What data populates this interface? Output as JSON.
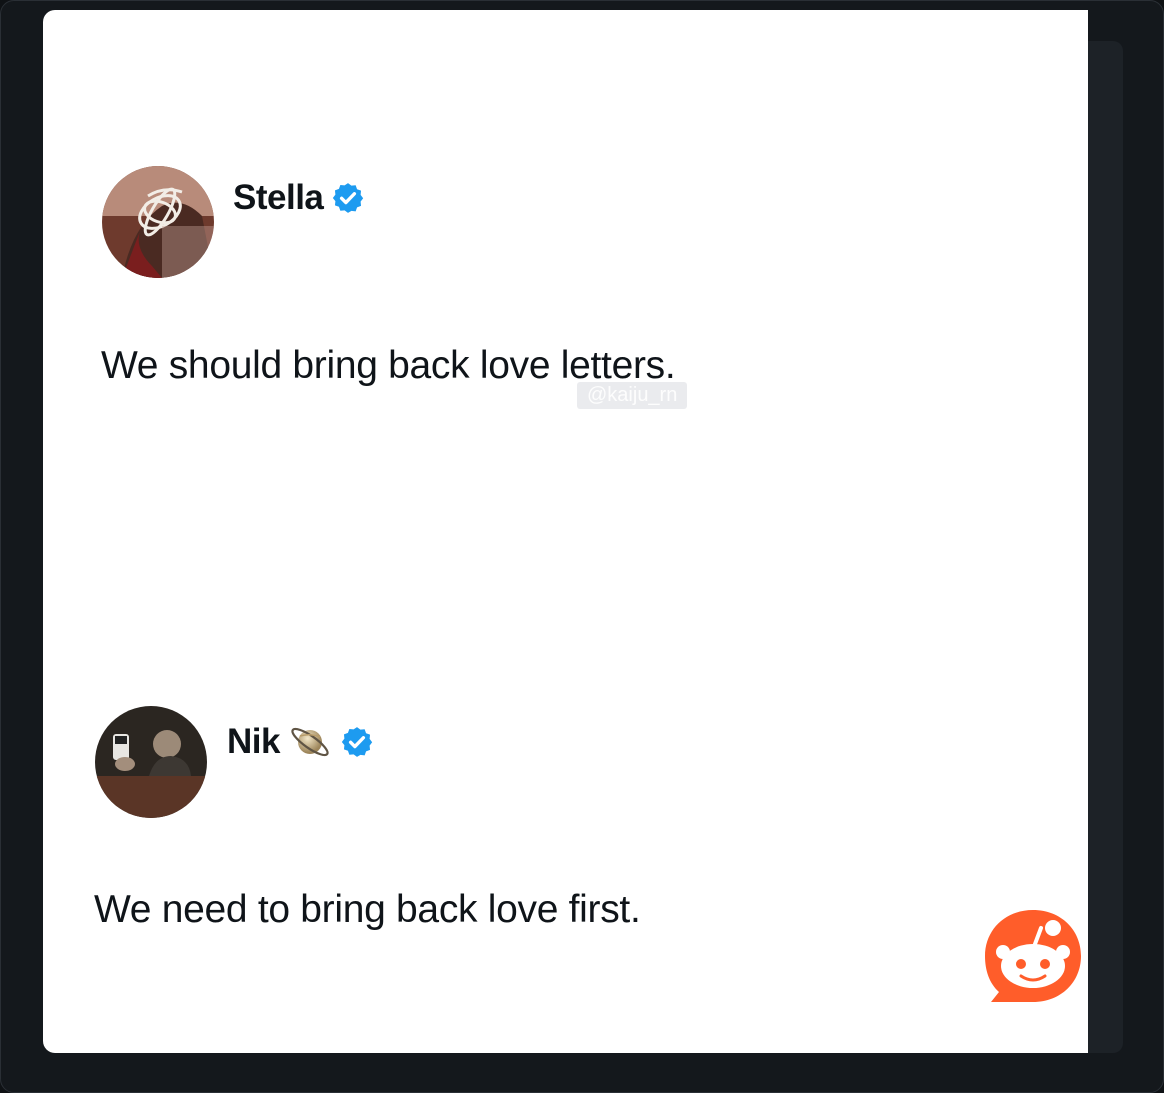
{
  "tweets": [
    {
      "author": "Stella",
      "verified": true,
      "text": "We should bring back love letters."
    },
    {
      "author": "Nik",
      "verified": true,
      "emoji": "planet-emoji",
      "text": "We need to bring back love first."
    }
  ],
  "watermark": "@kaiju_rn",
  "colors": {
    "verified": "#1d9bf0",
    "reddit": "#ff5700",
    "text": "#0f1419"
  }
}
